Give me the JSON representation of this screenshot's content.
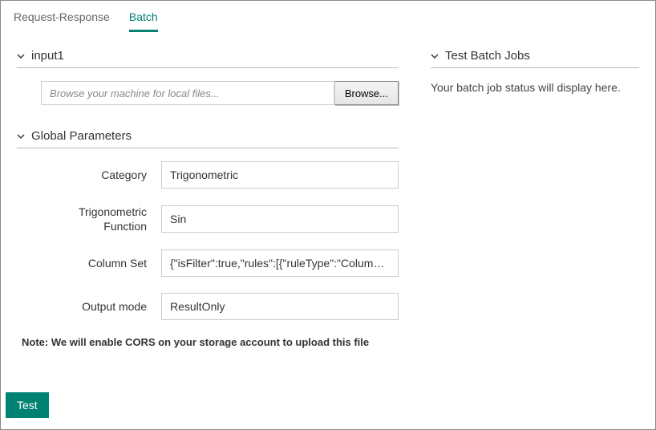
{
  "tabs": {
    "request_response": "Request-Response",
    "batch": "Batch"
  },
  "sections": {
    "input1": {
      "title": "input1"
    },
    "global_params": {
      "title": "Global Parameters"
    },
    "test_jobs": {
      "title": "Test Batch Jobs"
    }
  },
  "file": {
    "placeholder": "Browse your machine for local files...",
    "browse_label": "Browse..."
  },
  "params": {
    "category": {
      "label": "Category",
      "value": "Trigonometric"
    },
    "trig_fn": {
      "label": "Trigonometric Function",
      "value": "Sin"
    },
    "column_set": {
      "label": "Column Set",
      "value": "{\"isFilter\":true,\"rules\":[{\"ruleType\":\"ColumnTyp"
    },
    "output_mode": {
      "label": "Output mode",
      "value": "ResultOnly"
    }
  },
  "note": "Note: We will enable CORS on your storage account to upload this file",
  "test_button": "Test",
  "batch_status": "Your batch job status will display here."
}
